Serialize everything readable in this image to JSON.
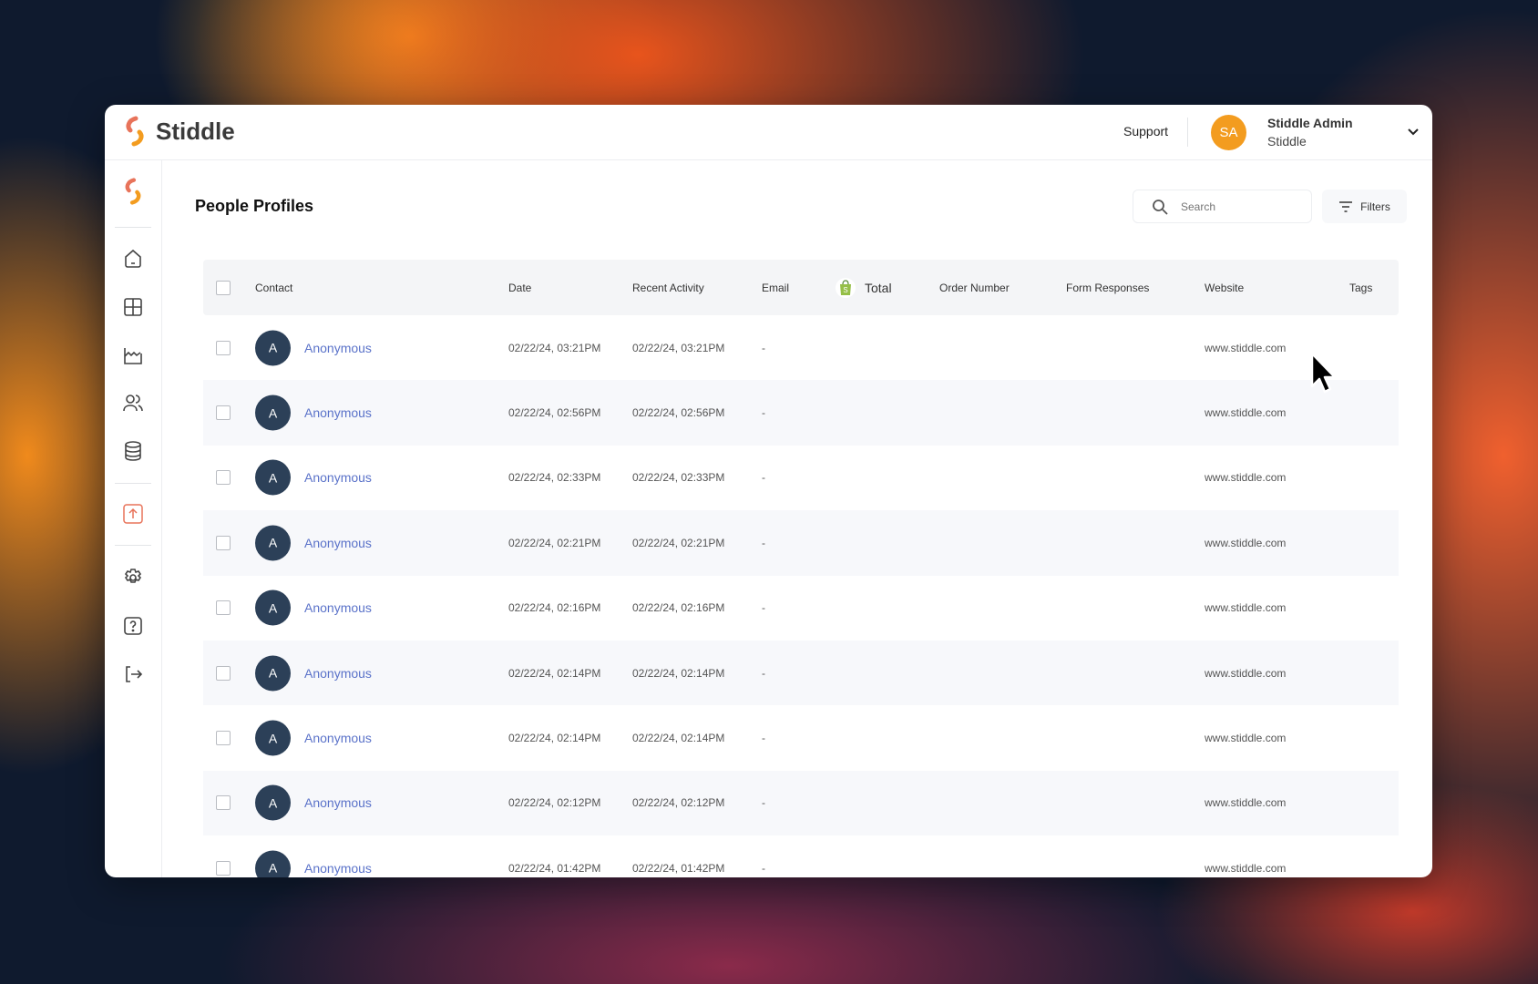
{
  "app": {
    "brand": "Stiddle"
  },
  "header": {
    "support": "Support",
    "user_initials": "SA",
    "user_name": "Stiddle Admin",
    "user_org": "Stiddle"
  },
  "page": {
    "title": "People Profiles",
    "search_placeholder": "Search",
    "filters_label": "Filters"
  },
  "table": {
    "columns": [
      "Contact",
      "Date",
      "Recent Activity",
      "Email",
      "Total",
      "Order Number",
      "Form Responses",
      "Website",
      "Tags"
    ],
    "rows": [
      {
        "initial": "A",
        "contact": "Anonymous",
        "date": "02/22/24, 03:21PM",
        "recent": "02/22/24, 03:21PM",
        "email": "-",
        "website": "www.stiddle.com"
      },
      {
        "initial": "A",
        "contact": "Anonymous",
        "date": "02/22/24, 02:56PM",
        "recent": "02/22/24, 02:56PM",
        "email": "-",
        "website": "www.stiddle.com"
      },
      {
        "initial": "A",
        "contact": "Anonymous",
        "date": "02/22/24, 02:33PM",
        "recent": "02/22/24, 02:33PM",
        "email": "-",
        "website": "www.stiddle.com"
      },
      {
        "initial": "A",
        "contact": "Anonymous",
        "date": "02/22/24, 02:21PM",
        "recent": "02/22/24, 02:21PM",
        "email": "-",
        "website": "www.stiddle.com"
      },
      {
        "initial": "A",
        "contact": "Anonymous",
        "date": "02/22/24, 02:16PM",
        "recent": "02/22/24, 02:16PM",
        "email": "-",
        "website": "www.stiddle.com"
      },
      {
        "initial": "A",
        "contact": "Anonymous",
        "date": "02/22/24, 02:14PM",
        "recent": "02/22/24, 02:14PM",
        "email": "-",
        "website": "www.stiddle.com"
      },
      {
        "initial": "A",
        "contact": "Anonymous",
        "date": "02/22/24, 02:14PM",
        "recent": "02/22/24, 02:14PM",
        "email": "-",
        "website": "www.stiddle.com"
      },
      {
        "initial": "A",
        "contact": "Anonymous",
        "date": "02/22/24, 02:12PM",
        "recent": "02/22/24, 02:12PM",
        "email": "-",
        "website": "www.stiddle.com"
      },
      {
        "initial": "A",
        "contact": "Anonymous",
        "date": "02/22/24, 01:42PM",
        "recent": "02/22/24, 01:42PM",
        "email": "-",
        "website": "www.stiddle.com"
      }
    ]
  },
  "colors": {
    "accent": "#f39c1f",
    "link": "#5a72c9",
    "avatar": "#2c4058"
  }
}
